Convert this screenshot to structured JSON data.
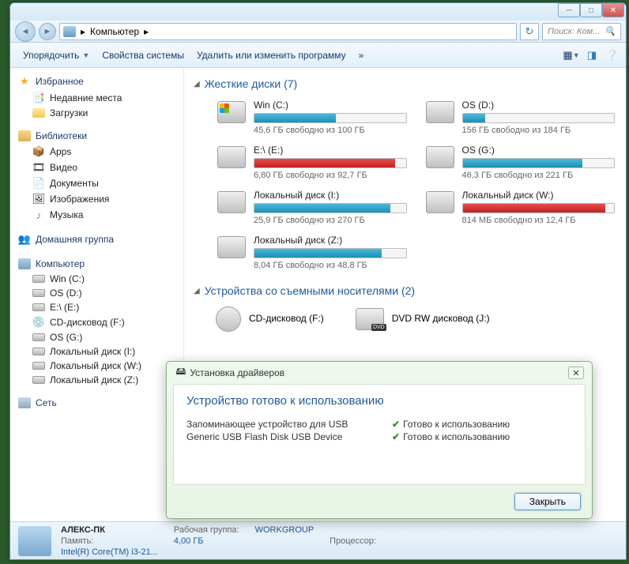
{
  "breadcrumb": {
    "location": "Компьютер"
  },
  "search": {
    "placeholder": "Поиск: Ком..."
  },
  "toolbar": {
    "organize": "Упорядочить",
    "properties": "Свойства системы",
    "uninstall": "Удалить или изменить программу",
    "chevrons": "»"
  },
  "sidebar": {
    "favorites": {
      "label": "Избранное",
      "items": [
        "Недавние места",
        "Загрузки"
      ]
    },
    "libraries": {
      "label": "Библиотеки",
      "items": [
        "Apps",
        "Видео",
        "Документы",
        "Изображения",
        "Музыка"
      ]
    },
    "homegroup": "Домашняя группа",
    "computer": {
      "label": "Компьютер",
      "items": [
        "Win (C:)",
        "OS (D:)",
        "E:\\ (E:)",
        "CD-дисковод (F:)",
        "OS (G:)",
        "Локальный диск (I:)",
        "Локальный диск (W:)",
        "Локальный диск (Z:)"
      ]
    },
    "network": "Сеть"
  },
  "sections": {
    "hdd": "Жесткие диски (7)",
    "removable": "Устройства со съемными носителями (2)"
  },
  "drives": [
    {
      "name": "Win (C:)",
      "free": "45,6 ГБ свободно из 100 ГБ",
      "fill": 54,
      "red": false,
      "win": true
    },
    {
      "name": "OS (D:)",
      "free": "156 ГБ свободно из 184 ГБ",
      "fill": 15,
      "red": false,
      "win": false
    },
    {
      "name": "E:\\ (E:)",
      "free": "6,80 ГБ свободно из 92,7 ГБ",
      "fill": 93,
      "red": true,
      "win": false
    },
    {
      "name": "OS (G:)",
      "free": "46,3 ГБ свободно из 221 ГБ",
      "fill": 79,
      "red": false,
      "win": false
    },
    {
      "name": "Локальный диск (I:)",
      "free": "25,9 ГБ свободно из 270 ГБ",
      "fill": 90,
      "red": false,
      "win": false
    },
    {
      "name": "Локальный диск (W:)",
      "free": "814 МБ свободно из 12,4 ГБ",
      "fill": 94,
      "red": true,
      "win": false
    },
    {
      "name": "Локальный диск (Z:)",
      "free": "8,04 ГБ свободно из 48,8 ГБ",
      "fill": 84,
      "red": false,
      "win": false
    }
  ],
  "removable": [
    {
      "name": "CD-дисковод (F:)",
      "type": "cd"
    },
    {
      "name": "DVD RW дисковод (J:)",
      "type": "dvd"
    }
  ],
  "status": {
    "name": "АЛЕКС-ПК",
    "workgroup_label": "Рабочая группа:",
    "workgroup": "WORKGROUP",
    "memory_label": "Память:",
    "memory": "4,00 ГБ",
    "cpu_label": "Процессор:",
    "cpu": "Intel(R) Core(TM) i3-21..."
  },
  "popup": {
    "title": "Установка драйверов",
    "heading": "Устройство готово к использованию",
    "rows": [
      {
        "device": "Запоминающее устройство для USB",
        "status": "Готово к использованию"
      },
      {
        "device": "Generic USB Flash Disk USB Device",
        "status": "Готово к использованию"
      }
    ],
    "close": "Закрыть"
  }
}
